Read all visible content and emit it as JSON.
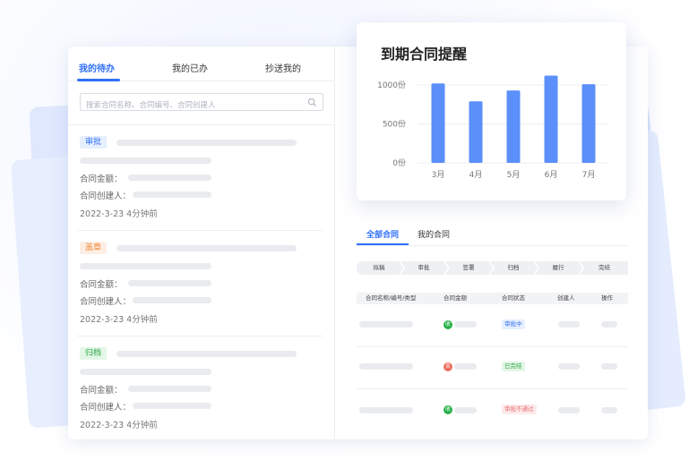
{
  "tabs": {
    "todo": "我的待办",
    "done": "我的已办",
    "cc": "抄送我的"
  },
  "search": {
    "placeholder": "搜索合同名称、合同编号、合同创建人"
  },
  "items": [
    {
      "badge": "审批",
      "amount_label": "合同金额：",
      "creator_label": "合同创建人：",
      "time": "2022-3-23  4分钟前"
    },
    {
      "badge": "盖章",
      "amount_label": "合同金额：",
      "creator_label": "合同创建人：",
      "time": "2022-3-23  4分钟前"
    },
    {
      "badge": "归档",
      "amount_label": "合同金额：",
      "creator_label": "合同创建人：",
      "time": "2022-3-23  4分钟前"
    }
  ],
  "chart": {
    "title": "到期合同提醒"
  },
  "chart_data": {
    "type": "bar",
    "title": "到期合同提醒",
    "categories": [
      "3月",
      "4月",
      "5月",
      "6月",
      "7月"
    ],
    "values": [
      1020,
      790,
      930,
      1120,
      1010
    ],
    "ylim": [
      0,
      1000
    ],
    "yticks": [
      "0份",
      "500份",
      "1000份"
    ],
    "grid": true,
    "color": "#5b8ff9"
  },
  "contract_tabs": {
    "all": "全部合同",
    "mine": "我的合同"
  },
  "steps": [
    "拟稿",
    "审批",
    "签署",
    "归档",
    "履行",
    "完结"
  ],
  "table": {
    "headers": [
      "合同名称/编号/类型",
      "合同金额",
      "合同状态",
      "创建人",
      "操作"
    ],
    "rows": [
      {
        "currency": "收",
        "status": "审批中"
      },
      {
        "currency": "支",
        "status": "已完结"
      },
      {
        "currency": "收",
        "status": "审批不通过"
      }
    ]
  },
  "colors": {
    "accent": "#2f6ff7",
    "bar": "#5b8ff9",
    "orange": "#f08a3a",
    "green": "#28a745",
    "red": "#e86b6b"
  }
}
